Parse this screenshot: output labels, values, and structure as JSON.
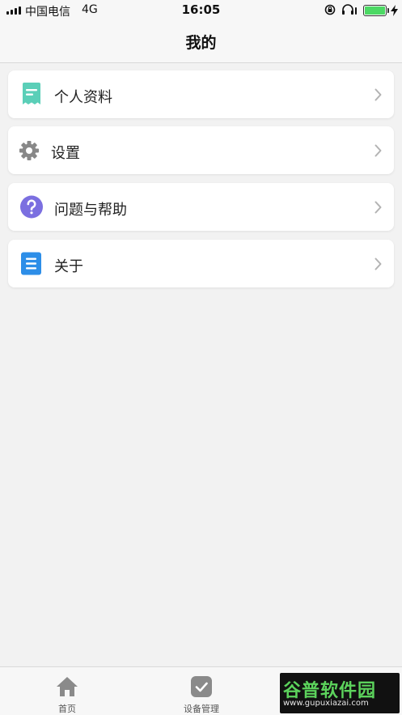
{
  "status_bar": {
    "carrier": "中国电信",
    "network": "4G",
    "time": "16:05",
    "battery_level": 1.0
  },
  "nav": {
    "title": "我的"
  },
  "menu": [
    {
      "label": "个人资料",
      "icon": "profile-doc-icon",
      "color": "#5bcfb8"
    },
    {
      "label": "设置",
      "icon": "gear-icon",
      "color": "#888888"
    },
    {
      "label": "问题与帮助",
      "icon": "question-icon",
      "color": "#7b6fe0"
    },
    {
      "label": "关于",
      "icon": "list-doc-icon",
      "color": "#2d8ee8"
    }
  ],
  "tabs": [
    {
      "label": "首页",
      "icon": "home-icon"
    },
    {
      "label": "设备管理",
      "icon": "checkbox-icon"
    }
  ],
  "watermark": {
    "text": "谷普软件园",
    "url": "www.gupuxiazai.com"
  }
}
